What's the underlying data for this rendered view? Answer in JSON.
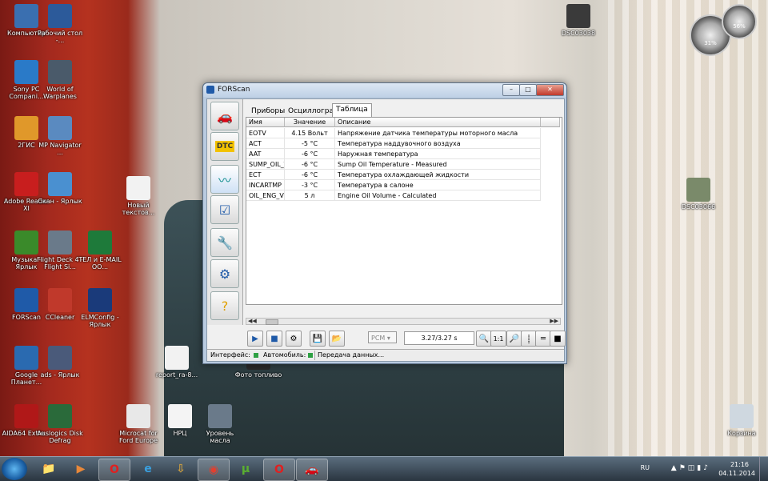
{
  "desktop": {
    "icons": [
      {
        "label": "Компьютер",
        "icon": "computer-icon",
        "color": "#3a6fb0"
      },
      {
        "label": "Рабочий стол -...",
        "icon": "desktop-icon",
        "color": "#2c5a9a"
      },
      {
        "label": "Sony PC Compani...",
        "icon": "sony-icon",
        "color": "#2a7ac8"
      },
      {
        "label": "World of Warplanes",
        "icon": "warplanes-icon",
        "color": "#4a5a6a"
      },
      {
        "label": "2ГИС",
        "icon": "2gis-icon",
        "color": "#e0982a"
      },
      {
        "label": "MP Navigator ...",
        "icon": "mp-navigator-icon",
        "color": "#5a8ac0"
      },
      {
        "label": "Adobe Reader XI",
        "icon": "adobe-reader-icon",
        "color": "#c81e1e"
      },
      {
        "label": "Скан - Ярлык",
        "icon": "scan-icon",
        "color": "#4a90d0"
      },
      {
        "label": "Новый текстов...",
        "icon": "text-file-icon",
        "color": "#f2f2f2"
      },
      {
        "label": "Музыка - Ярлык",
        "icon": "music-icon",
        "color": "#3a8a2a"
      },
      {
        "label": "Flight Deck 4 - Flight Si...",
        "icon": "flight-deck-icon",
        "color": "#6a7a8a"
      },
      {
        "label": "ТЕЛ и E-MAIL ОО...",
        "icon": "excel-icon",
        "color": "#1e7a3a"
      },
      {
        "label": "FORScan",
        "icon": "forscan-icon",
        "color": "#1f5aa8"
      },
      {
        "label": "CCleaner",
        "icon": "ccleaner-icon",
        "color": "#c0392b"
      },
      {
        "label": "ELMConfig - Ярлык",
        "icon": "elmconfig-icon",
        "color": "#1a3a7a"
      },
      {
        "label": "Google Планет...",
        "icon": "google-earth-icon",
        "color": "#2a6ab0"
      },
      {
        "label": "ads - Ярлык",
        "icon": "ads-icon",
        "color": "#4a5a7a"
      },
      {
        "label": "report_ra-8...",
        "icon": "pdf-icon",
        "color": "#f2f2f2"
      },
      {
        "label": "Фото топливо",
        "icon": "folder-icon",
        "color": "#2a2a2a"
      },
      {
        "label": "AIDA64 Extre...",
        "icon": "aida64-icon",
        "color": "#b01818"
      },
      {
        "label": "Auslogics Disk Defrag",
        "icon": "defrag-icon",
        "color": "#2a6a3a"
      },
      {
        "label": "Microcat for Ford Europe",
        "icon": "microcat-icon",
        "color": "#e8e8e8"
      },
      {
        "label": "НРЦ",
        "icon": "nrc-icon",
        "color": "#f4f4f4"
      },
      {
        "label": "Уровень масла",
        "icon": "oil-level-icon",
        "color": "#6a7a8a"
      },
      {
        "label": "DSC03038",
        "icon": "photo-icon",
        "color": "#3a3a3a"
      },
      {
        "label": "DSC03066",
        "icon": "photo-icon",
        "color": "#7a8a6a"
      },
      {
        "label": "Корзина",
        "icon": "recycle-bin-icon",
        "color": "#cfd8e0"
      }
    ],
    "gadget": {
      "cpu": "31%",
      "ram": "56%"
    }
  },
  "window": {
    "title": "FORScan",
    "tabs": [
      "Приборы",
      "Осциллограф",
      "Таблица"
    ],
    "active_tab": "Таблица",
    "columns": [
      "Имя",
      "Значение",
      "Описание"
    ],
    "rows": [
      {
        "name": "EOTV",
        "value": "4.15 Вольт",
        "desc": "Напряжение датчика температуры моторного масла"
      },
      {
        "name": "ACT",
        "value": "-5 °C",
        "desc": "Температура наддувочного воздуха"
      },
      {
        "name": "AAT",
        "value": "-6 °C",
        "desc": "Наружная температура"
      },
      {
        "name": "SUMP_OIL_T",
        "value": "-6 °C",
        "desc": "Sump Oil Temperature - Measured"
      },
      {
        "name": "ECT",
        "value": "-6 °C",
        "desc": "Температура охлаждающей жидкости"
      },
      {
        "name": "INCARTMP",
        "value": "-3 °C",
        "desc": "Температура в салоне"
      },
      {
        "name": "OIL_ENG_VO",
        "value": "5 л",
        "desc": "Engine Oil Volume - Calculated"
      }
    ],
    "toolbar": {
      "module": "PCM",
      "time": "3.27/3.27 s",
      "zoom": "1:1"
    },
    "status": {
      "interface_label": "Интерфейс:",
      "car_label": "Автомобиль:",
      "message": "Передача данных..."
    }
  },
  "taskbar": {
    "lang": "RU",
    "time": "21:16",
    "date": "04.11.2014"
  }
}
